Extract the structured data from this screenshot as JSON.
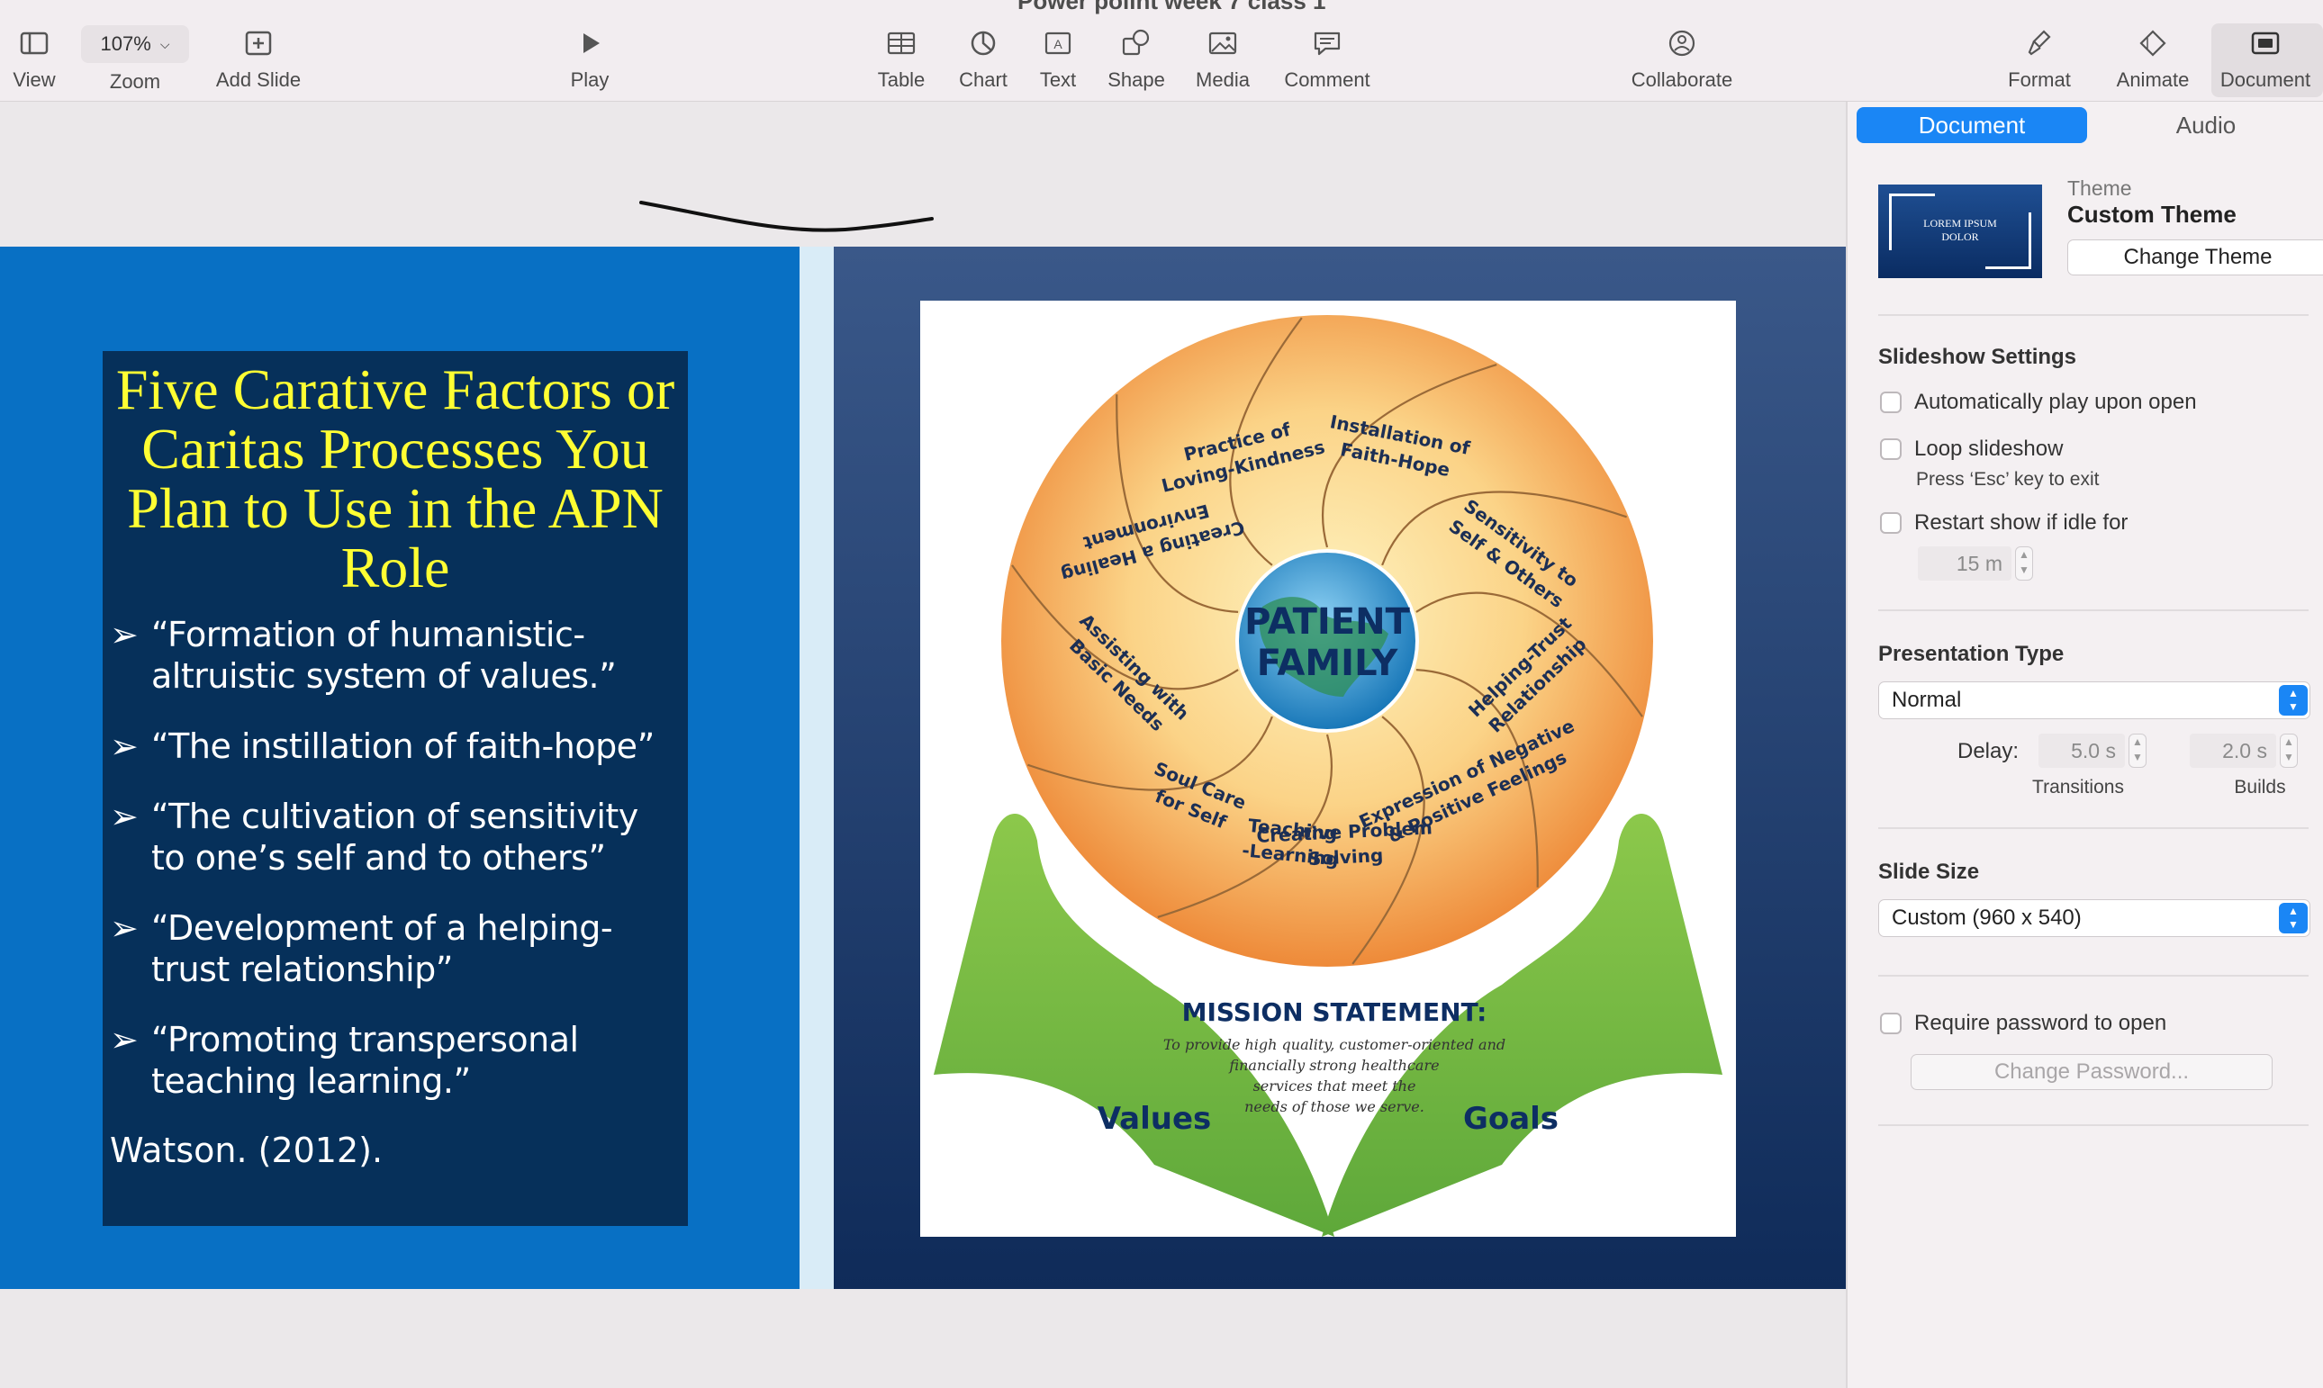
{
  "window": {
    "title": "Power poiint week 7 class 1"
  },
  "toolbar": {
    "view": "View",
    "zoom_value": "107%",
    "zoom": "Zoom",
    "add_slide": "Add Slide",
    "play": "Play",
    "table": "Table",
    "chart": "Chart",
    "text": "Text",
    "shape": "Shape",
    "media": "Media",
    "comment": "Comment",
    "collaborate": "Collaborate",
    "format": "Format",
    "animate": "Animate",
    "document": "Document"
  },
  "slide": {
    "title": "Five Carative Factors or Caritas Processes You Plan to Use in the APN Role",
    "bullet_symbol": "➢",
    "bullets": [
      "“Formation of humanistic-altruistic  system of values.”",
      "“The instillation of faith-hope”",
      "“The cultivation of sensitivity to one’s self and to others”",
      "“Development of a helping-trust relationship”",
      "“Promoting transpersonal teaching  learning.”"
    ],
    "citation": "Watson. (2012)."
  },
  "figure": {
    "center_line1": "PATIENT",
    "center_line2": "FAMILY",
    "petals": [
      "Practice of",
      "Loving-Kindness",
      "Installation of",
      "Faith-Hope",
      "Sensitivity to",
      "Self & Others",
      "Helping-Trust",
      "Relationship",
      "Expression of Negative",
      "& Positive Feelings",
      "Creative Problem",
      "Solving",
      "Teaching",
      "-Learning",
      "Soul Care",
      "for Self",
      "Assisting with",
      "Basic Needs",
      "Creating a Healing",
      "Environment"
    ],
    "mission_title": "MISSION STATEMENT:",
    "mission_lines": [
      "To provide high quality, customer-oriented and",
      "financially strong healthcare",
      "services that meet the",
      "needs of those we serve."
    ],
    "left_hand": "Values",
    "right_hand": "Goals",
    "colors": {
      "orange": "#f0913a",
      "light": "#fde7a6",
      "navy": "#0d2e63",
      "green": "#7cbf3f",
      "blue": "#1d7fc0"
    }
  },
  "inspector": {
    "tabs": [
      "Document",
      "Audio"
    ],
    "theme_label": "Theme",
    "theme_name": "Custom Theme",
    "theme_thumb_line1": "LOREM IPSUM",
    "theme_thumb_line2": "DOLOR",
    "change_theme": "Change Theme",
    "slideshow_title": "Slideshow Settings",
    "auto_play": "Automatically play upon open",
    "loop": "Loop slideshow",
    "loop_hint": "Press ‘Esc’ key to exit",
    "restart": "Restart show if idle for",
    "idle_value": "15 m",
    "presentation_type_title": "Presentation Type",
    "presentation_type": "Normal",
    "delay_label": "Delay:",
    "transitions_value": "5.0 s",
    "builds_value": "2.0 s",
    "transitions_label": "Transitions",
    "builds_label": "Builds",
    "slide_size_title": "Slide Size",
    "slide_size": "Custom (960 x 540)",
    "require_password": "Require password to open",
    "change_password": "Change Password..."
  }
}
